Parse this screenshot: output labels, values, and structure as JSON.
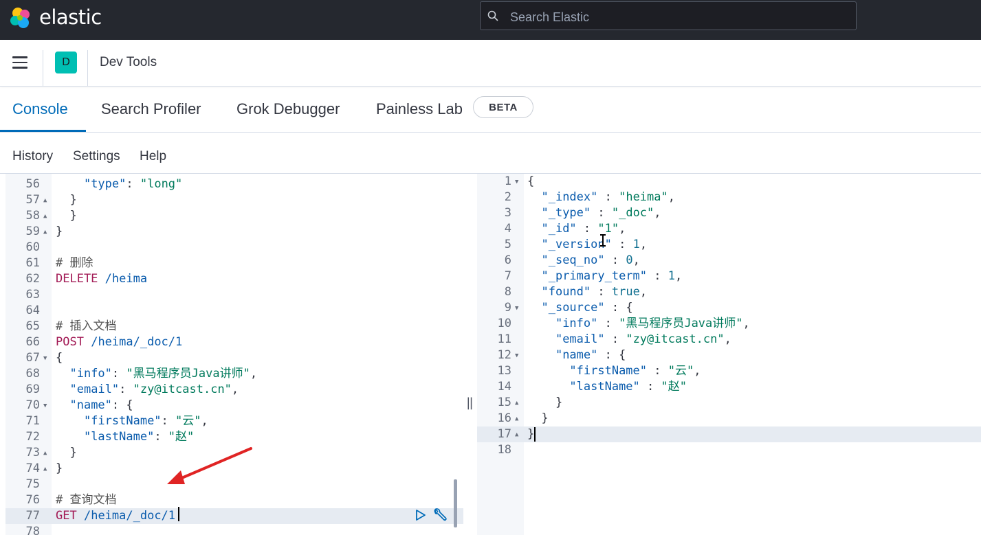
{
  "topbar": {
    "brand": "elastic",
    "search_placeholder": "Search Elastic"
  },
  "header": {
    "avatar_letter": "D",
    "title": "Dev Tools"
  },
  "tabs": [
    {
      "label": "Console",
      "active": true
    },
    {
      "label": "Search Profiler"
    },
    {
      "label": "Grok Debugger"
    },
    {
      "label": "Painless Lab"
    }
  ],
  "beta_badge": "BETA",
  "menu": {
    "history": "History",
    "settings": "Settings",
    "help": "Help"
  },
  "request_editor": {
    "lines": [
      {
        "n": "56",
        "text": "    \"type\": \"long\""
      },
      {
        "n": "57",
        "text": "  }"
      },
      {
        "n": "58",
        "text": "  }"
      },
      {
        "n": "59",
        "text": "}"
      },
      {
        "n": "60",
        "text": ""
      },
      {
        "n": "61",
        "text": "# 删除"
      },
      {
        "n": "62",
        "text": "DELETE /heima"
      },
      {
        "n": "63",
        "text": ""
      },
      {
        "n": "64",
        "text": ""
      },
      {
        "n": "65",
        "text": "# 插入文档"
      },
      {
        "n": "66",
        "text": "POST /heima/_doc/1"
      },
      {
        "n": "67",
        "text": "{"
      },
      {
        "n": "68",
        "text": "  \"info\": \"黑马程序员Java讲师\","
      },
      {
        "n": "69",
        "text": "  \"email\": \"zy@itcast.cn\","
      },
      {
        "n": "70",
        "text": "  \"name\": {"
      },
      {
        "n": "71",
        "text": "    \"firstName\": \"云\","
      },
      {
        "n": "72",
        "text": "    \"lastName\": \"赵\""
      },
      {
        "n": "73",
        "text": "  }"
      },
      {
        "n": "74",
        "text": "}"
      },
      {
        "n": "75",
        "text": ""
      },
      {
        "n": "76",
        "text": "# 查询文档"
      },
      {
        "n": "77",
        "text": "GET /heima/_doc/1"
      },
      {
        "n": "78",
        "text": ""
      }
    ]
  },
  "response_editor": {
    "lines": [
      {
        "n": "1",
        "text": "{"
      },
      {
        "n": "2",
        "text": "  \"_index\" : \"heima\","
      },
      {
        "n": "3",
        "text": "  \"_type\" : \"_doc\","
      },
      {
        "n": "4",
        "text": "  \"_id\" : \"1\","
      },
      {
        "n": "5",
        "text": "  \"_version\" : 1,"
      },
      {
        "n": "6",
        "text": "  \"_seq_no\" : 0,"
      },
      {
        "n": "7",
        "text": "  \"_primary_term\" : 1,"
      },
      {
        "n": "8",
        "text": "  \"found\" : true,"
      },
      {
        "n": "9",
        "text": "  \"_source\" : {"
      },
      {
        "n": "10",
        "text": "    \"info\" : \"黑马程序员Java讲师\","
      },
      {
        "n": "11",
        "text": "    \"email\" : \"zy@itcast.cn\","
      },
      {
        "n": "12",
        "text": "    \"name\" : {"
      },
      {
        "n": "13",
        "text": "      \"firstName\" : \"云\","
      },
      {
        "n": "14",
        "text": "      \"lastName\" : \"赵\""
      },
      {
        "n": "15",
        "text": "    }"
      },
      {
        "n": "16",
        "text": "  }"
      },
      {
        "n": "17",
        "text": "}"
      },
      {
        "n": "18",
        "text": ""
      }
    ]
  },
  "icons": {
    "logo": "elastic-logo",
    "search": "search-icon",
    "menu": "hamburger-menu-icon",
    "run": "play-icon",
    "wrench": "wrench-icon",
    "arrow": "red-arrow-annotation"
  },
  "colors": {
    "accent": "#006bb8",
    "topbar": "#25282f",
    "avatar": "#00bfb3",
    "annotation": "#e02424"
  }
}
